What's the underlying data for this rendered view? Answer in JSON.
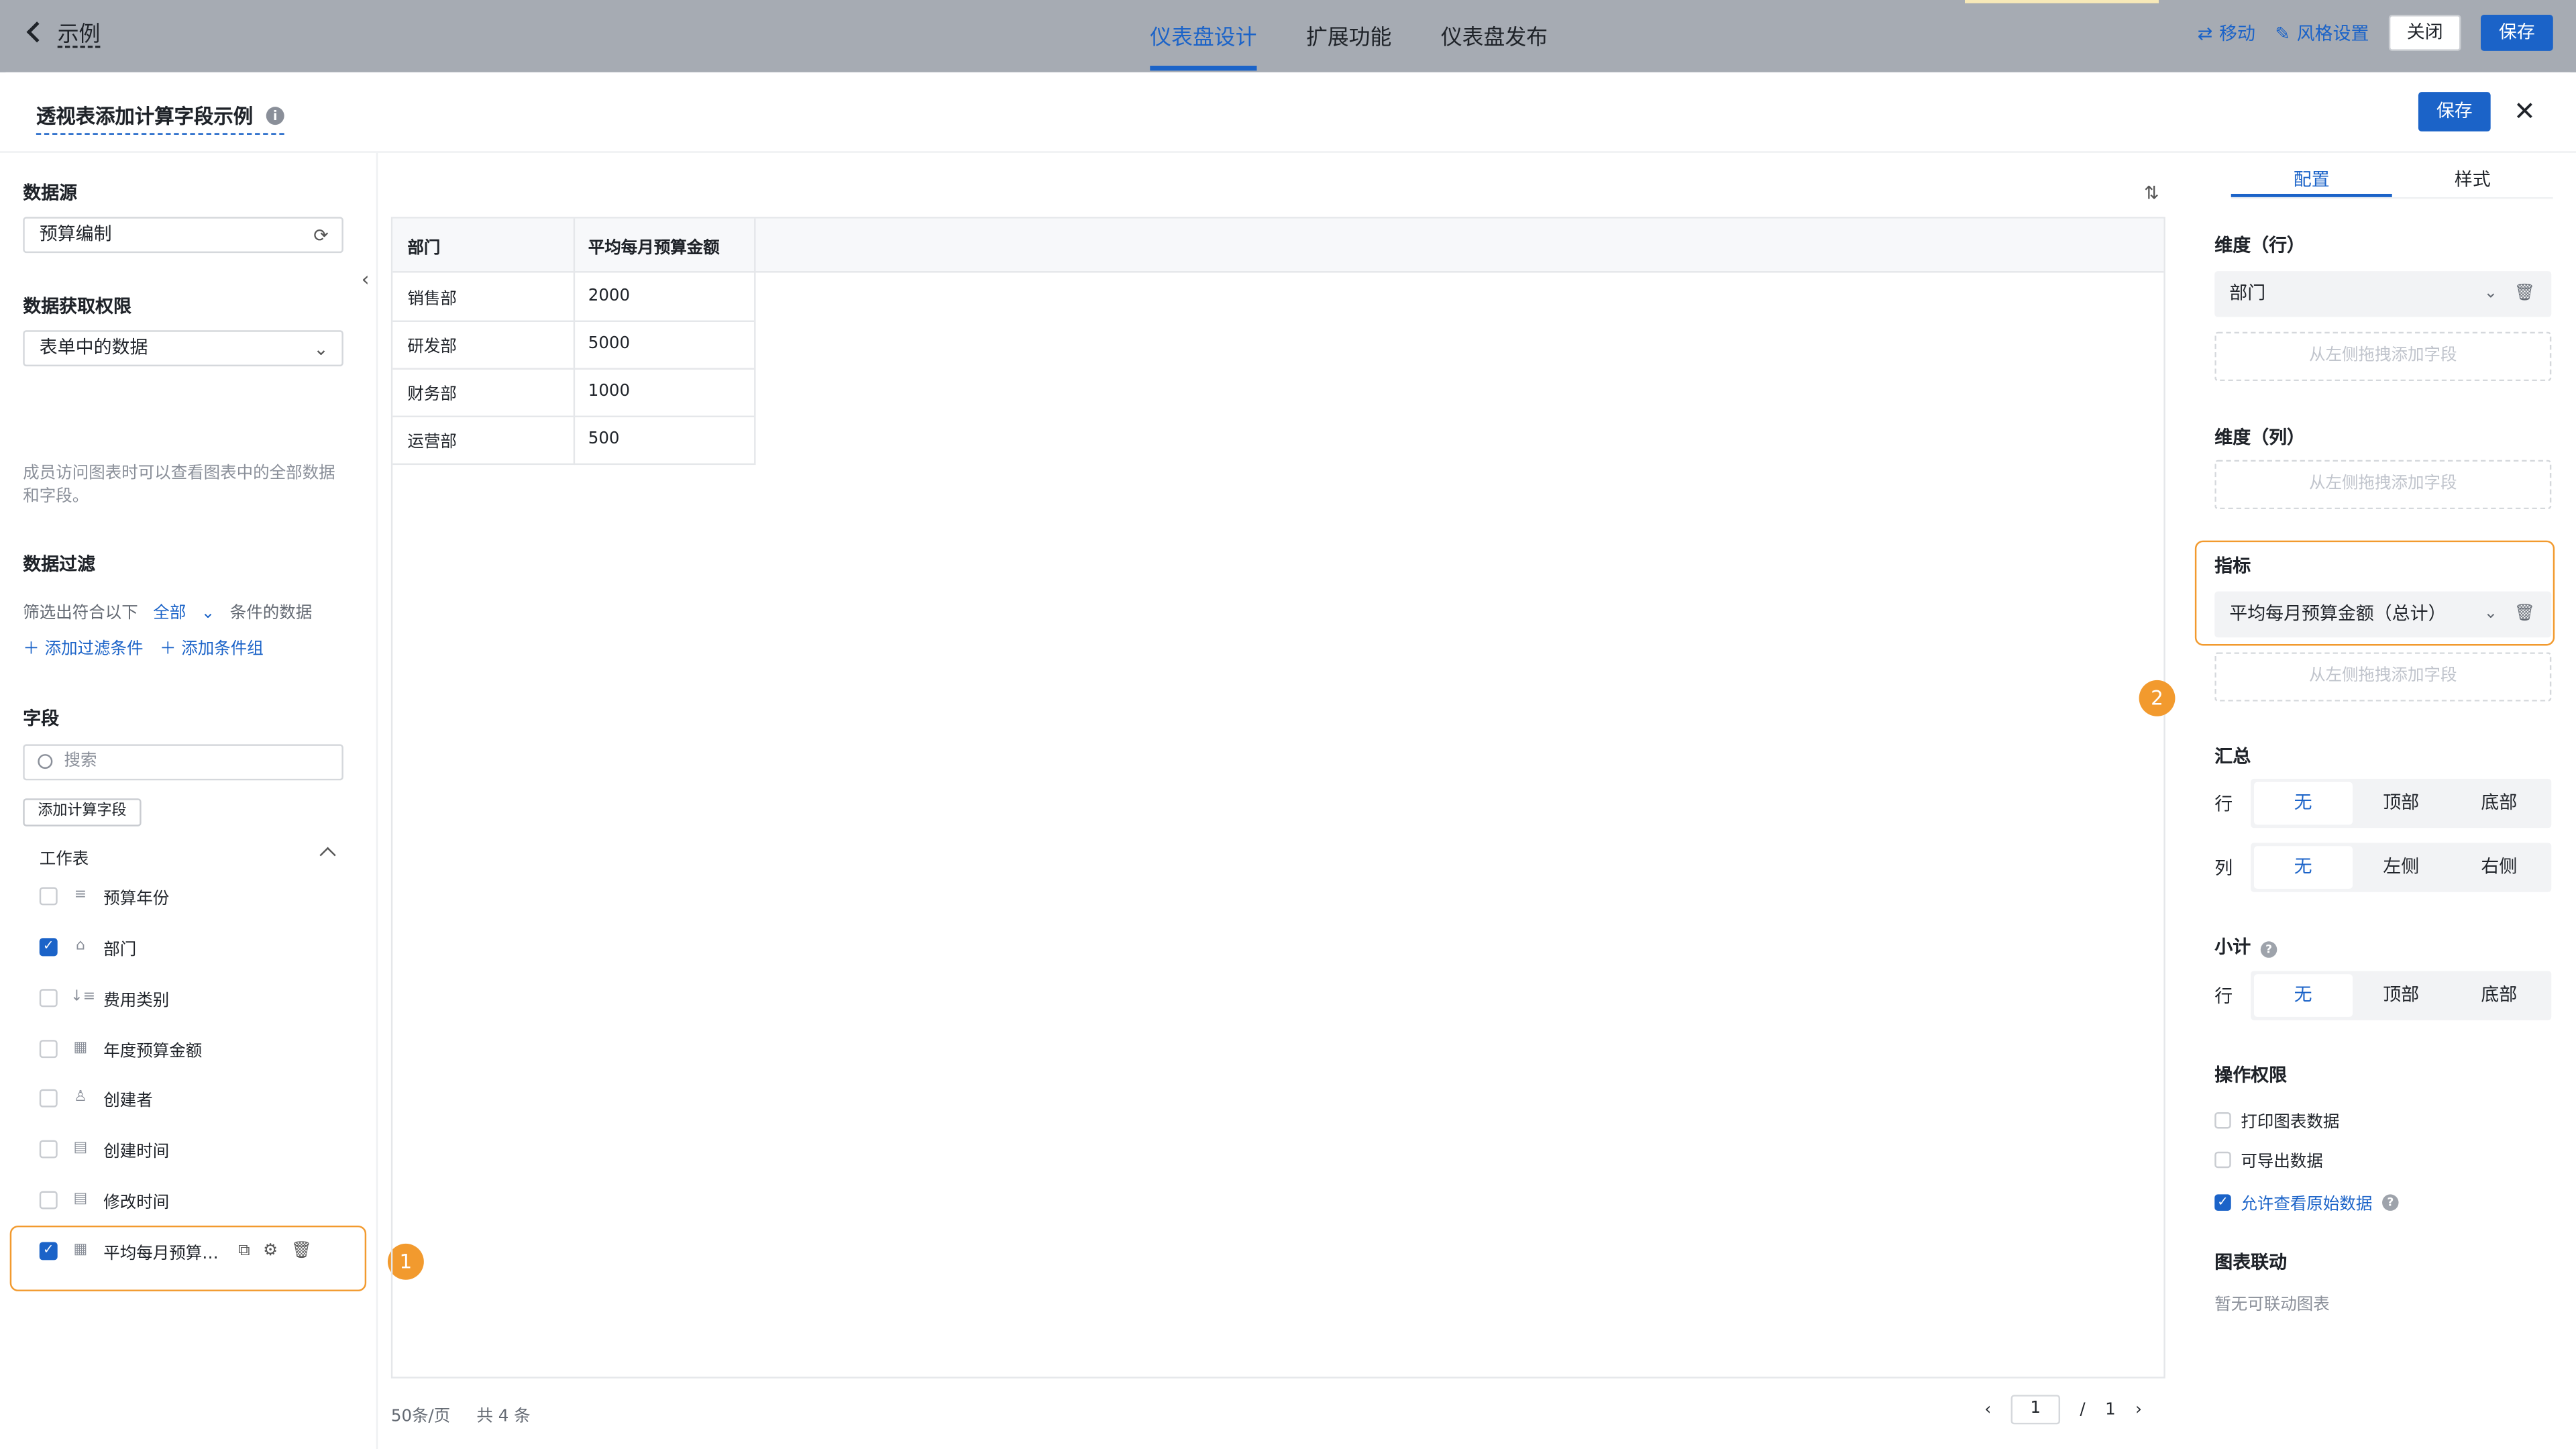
{
  "topbar": {
    "back_label": "示例",
    "tabs": [
      "仪表盘设计",
      "扩展功能",
      "仪表盘发布"
    ],
    "move_label": "移动",
    "style_label": "风格设置",
    "close_label": "关闭",
    "save_label": "保存"
  },
  "header": {
    "title": "透视表添加计算字段示例",
    "save_label": "保存",
    "close_symbol": "✕"
  },
  "left": {
    "datasource_title": "数据源",
    "datasource_value": "预算编制",
    "permission_title": "数据获取权限",
    "permission_value": "表单中的数据",
    "permission_desc": "成员访问图表时可以查看图表中的全部数据和字段。",
    "filter_title": "数据过滤",
    "filter_prefix": "筛选出符合以下",
    "filter_mode": "全部",
    "filter_suffix": "条件的数据",
    "add_condition": "添加过滤条件",
    "add_group": "添加条件组",
    "fields_title": "字段",
    "search_placeholder": "搜索",
    "add_calc_label": "添加计算字段",
    "worksheet_label": "工作表",
    "fields": [
      {
        "label": "预算年份",
        "icon": "text-icon",
        "checked": false
      },
      {
        "label": "部门",
        "icon": "department-icon",
        "checked": true
      },
      {
        "label": "费用类别",
        "icon": "sort-list-icon",
        "checked": false
      },
      {
        "label": "年度预算金额",
        "icon": "number-icon",
        "checked": false
      },
      {
        "label": "创建者",
        "icon": "user-icon",
        "checked": false
      },
      {
        "label": "创建时间",
        "icon": "calendar-icon",
        "checked": false
      },
      {
        "label": "修改时间",
        "icon": "calendar-icon",
        "checked": false
      },
      {
        "label": "平均每月预算…",
        "icon": "number-icon",
        "checked": true
      }
    ],
    "badge1": "1"
  },
  "table": {
    "headers": [
      "部门",
      "平均每月预算金额"
    ],
    "rows": [
      [
        "销售部",
        "2000"
      ],
      [
        "研发部",
        "5000"
      ],
      [
        "财务部",
        "1000"
      ],
      [
        "运营部",
        "500"
      ]
    ],
    "page_size": "50条/页",
    "total": "共 4 条",
    "current_page": "1",
    "page_sep": "/",
    "total_pages": "1"
  },
  "config": {
    "tab_config": "配置",
    "tab_style": "样式",
    "dim_row_title": "维度（行）",
    "dim_row_value": "部门",
    "drop_hint": "从左侧拖拽添加字段",
    "dim_col_title": "维度（列）",
    "measure_title": "指标",
    "measure_value": "平均每月预算金额（总计）",
    "badge2": "2",
    "summary_title": "汇总",
    "row_label": "行",
    "col_label": "列",
    "summary_row_opts": [
      "无",
      "顶部",
      "底部"
    ],
    "summary_col_opts": [
      "无",
      "左侧",
      "右侧"
    ],
    "subtotal_title": "小计",
    "subtotal_row_opts": [
      "无",
      "顶部",
      "底部"
    ],
    "perm_title": "操作权限",
    "perm_print": "打印图表数据",
    "perm_export": "可导出数据",
    "perm_view_raw": "允许查看原始数据",
    "link_title": "图表联动",
    "link_empty": "暂无可联动图表"
  },
  "colors": {
    "primary": "#1b63c8",
    "highlight": "#f29a2e"
  }
}
